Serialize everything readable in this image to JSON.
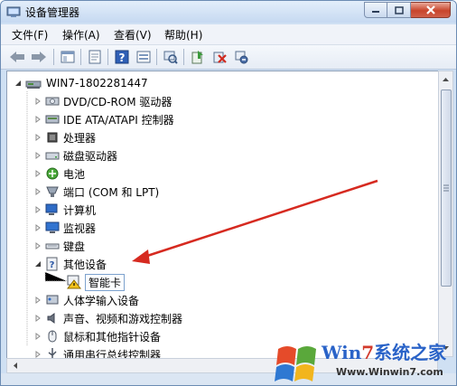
{
  "window": {
    "title": "设备管理器"
  },
  "menu": [
    "文件(F)",
    "操作(A)",
    "查看(V)",
    "帮助(H)"
  ],
  "toolbar": [
    {
      "icon": "back-arrow-icon"
    },
    {
      "icon": "forward-arrow-icon"
    },
    {
      "icon": "show-hide-tree-icon"
    },
    {
      "icon": "properties-icon"
    },
    {
      "icon": "help-icon"
    },
    {
      "icon": "view-icon"
    },
    {
      "icon": "scan-hardware-icon"
    },
    {
      "icon": "update-driver-icon"
    },
    {
      "icon": "uninstall-icon"
    },
    {
      "icon": "disable-device-icon"
    }
  ],
  "tree": {
    "root": "WIN7-1802281447",
    "items": [
      {
        "label": "DVD/CD-ROM 驱动器",
        "icon": "dvd-drive-icon"
      },
      {
        "label": "IDE ATA/ATAPI 控制器",
        "icon": "ide-controller-icon"
      },
      {
        "label": "处理器",
        "icon": "processor-icon"
      },
      {
        "label": "磁盘驱动器",
        "icon": "disk-drive-icon"
      },
      {
        "label": "电池",
        "icon": "battery-icon"
      },
      {
        "label": "端口 (COM 和 LPT)",
        "icon": "port-icon"
      },
      {
        "label": "计算机",
        "icon": "computer-icon"
      },
      {
        "label": "监视器",
        "icon": "monitor-icon"
      },
      {
        "label": "键盘",
        "icon": "keyboard-icon"
      },
      {
        "label": "其他设备",
        "icon": "unknown-device-icon",
        "expanded": true
      },
      {
        "label": "智能卡",
        "icon": "warning-device-icon",
        "child": true
      },
      {
        "label": "人体学输入设备",
        "icon": "hid-icon"
      },
      {
        "label": "声音、视频和游戏控制器",
        "icon": "sound-icon"
      },
      {
        "label": "鼠标和其他指针设备",
        "icon": "mouse-icon"
      },
      {
        "label": "通用串行总线控制器",
        "icon": "usb-icon"
      }
    ]
  },
  "watermark": {
    "brand_a": "Win",
    "brand_seven": "7",
    "brand_b": "系统之家",
    "url": "Www.Winwin7.com"
  },
  "colors": {
    "arrow": "#d62a20",
    "selection_border": "#7da2ce"
  }
}
